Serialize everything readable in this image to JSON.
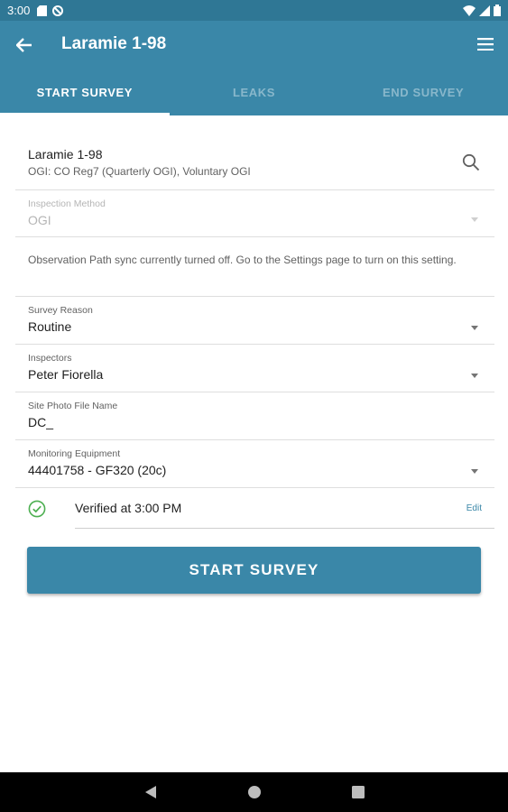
{
  "status_bar": {
    "time": "3:00"
  },
  "app_bar": {
    "title": "Laramie 1-98"
  },
  "tabs": [
    {
      "label": "START SURVEY",
      "active": true
    },
    {
      "label": "LEAKS",
      "active": false
    },
    {
      "label": "END SURVEY",
      "active": false
    }
  ],
  "site": {
    "name": "Laramie 1-98",
    "subtitle": "OGI: CO Reg7 (Quarterly OGI), Voluntary OGI"
  },
  "fields": {
    "inspection_method": {
      "label": "Inspection Method",
      "value": "OGI",
      "disabled": true
    },
    "observation_note": "Observation Path sync currently turned off. Go to the Settings page to turn on this setting.",
    "survey_reason": {
      "label": "Survey Reason",
      "value": "Routine"
    },
    "inspectors": {
      "label": "Inspectors",
      "value": "Peter Fiorella"
    },
    "site_photo": {
      "label": "Site Photo File Name",
      "value": "DC_"
    },
    "monitoring_equipment": {
      "label": "Monitoring Equipment",
      "value": "44401758 - GF320 (20c)"
    }
  },
  "verified": {
    "text": "Verified at 3:00 PM",
    "edit_label": "Edit"
  },
  "start_button": {
    "label": "START SURVEY"
  },
  "colors": {
    "primary": "#3a87a8",
    "status_bar": "#2f7795",
    "success": "#4caf50"
  },
  "icons": [
    "back-arrow-icon",
    "menu-icon",
    "search-icon",
    "check-circle-icon",
    "nav-back-icon",
    "nav-home-icon",
    "nav-recents-icon"
  ]
}
